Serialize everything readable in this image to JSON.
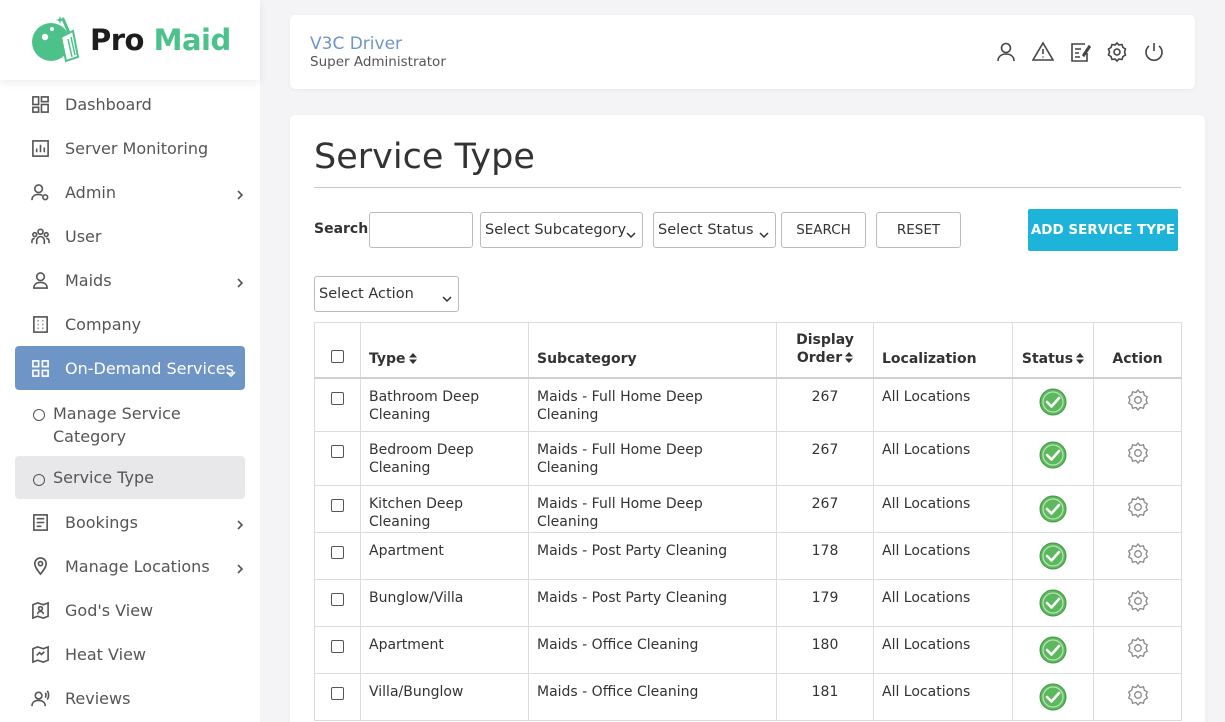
{
  "brand": {
    "name_part1": "Pro",
    "name_part2": "Maid",
    "accent_color": "#4cc28a"
  },
  "sidebar": {
    "items": [
      {
        "label": "Dashboard",
        "icon": "dashboard-icon",
        "has_children": false
      },
      {
        "label": "Server Monitoring",
        "icon": "bar-chart-icon",
        "has_children": false
      },
      {
        "label": "Admin",
        "icon": "admin-user-icon",
        "has_children": true
      },
      {
        "label": "User",
        "icon": "users-group-icon",
        "has_children": false
      },
      {
        "label": "Maids",
        "icon": "person-icon",
        "has_children": true
      },
      {
        "label": "Company",
        "icon": "building-icon",
        "has_children": false
      },
      {
        "label": "On-Demand Services",
        "icon": "grid-icon",
        "has_children": true,
        "active": true
      },
      {
        "label": "Bookings",
        "icon": "document-icon",
        "has_children": true
      },
      {
        "label": "Manage Locations",
        "icon": "location-pin-icon",
        "has_children": true
      },
      {
        "label": "God's View",
        "icon": "map-person-icon",
        "has_children": false
      },
      {
        "label": "Heat View",
        "icon": "heat-map-icon",
        "has_children": false
      },
      {
        "label": "Reviews",
        "icon": "reviews-icon",
        "has_children": false
      }
    ],
    "subitems": [
      {
        "label": "Manage Service Category",
        "line1": "Manage Service",
        "line2": "Category"
      },
      {
        "label": "Service Type",
        "active": true
      }
    ],
    "active_color": "#6f95c6"
  },
  "header": {
    "user_name": "V3C Driver",
    "user_role": "Super Administrator",
    "icons": [
      "profile-icon",
      "warning-icon",
      "edit-note-icon",
      "settings-icon",
      "power-icon"
    ]
  },
  "page": {
    "title": "Service Type",
    "search_label": "Search:",
    "search_value": "",
    "subcategory_select": "Select Subcategory",
    "status_select": "Select Status",
    "search_button": "SEARCH",
    "reset_button": "RESET",
    "add_button": "ADD SERVICE TYPE",
    "add_button_color": "#1eb3d8",
    "action_select": "Select Action"
  },
  "table": {
    "columns": {
      "type": "Type",
      "subcategory": "Subcategory",
      "display_order_line1": "Display",
      "display_order_line2": "Order",
      "localization": "Localization",
      "status": "Status",
      "action": "Action"
    },
    "rows": [
      {
        "type": "Bathroom Deep Cleaning",
        "subcategory": "Maids - Full Home Deep Cleaning",
        "display_order": "267",
        "localization": "All Locations",
        "status": "active"
      },
      {
        "type": "Bedroom Deep Cleaning",
        "subcategory": "Maids - Full Home Deep Cleaning",
        "display_order": "267",
        "localization": "All Locations",
        "status": "active"
      },
      {
        "type": "Kitchen Deep Cleaning",
        "subcategory": "Maids - Full Home Deep Cleaning",
        "display_order": "267",
        "localization": "All Locations",
        "status": "active"
      },
      {
        "type": "Apartment",
        "subcategory": "Maids - Post Party Cleaning",
        "display_order": "178",
        "localization": "All Locations",
        "status": "active"
      },
      {
        "type": "Bunglow/Villa",
        "subcategory": "Maids - Post Party Cleaning",
        "display_order": "179",
        "localization": "All Locations",
        "status": "active"
      },
      {
        "type": "Apartment",
        "subcategory": "Maids - Office Cleaning",
        "display_order": "180",
        "localization": "All Locations",
        "status": "active"
      },
      {
        "type": "Villa/Bunglow",
        "subcategory": "Maids - Office Cleaning",
        "display_order": "181",
        "localization": "All Locations",
        "status": "active"
      }
    ],
    "status_active_color": "#5cb85c"
  }
}
